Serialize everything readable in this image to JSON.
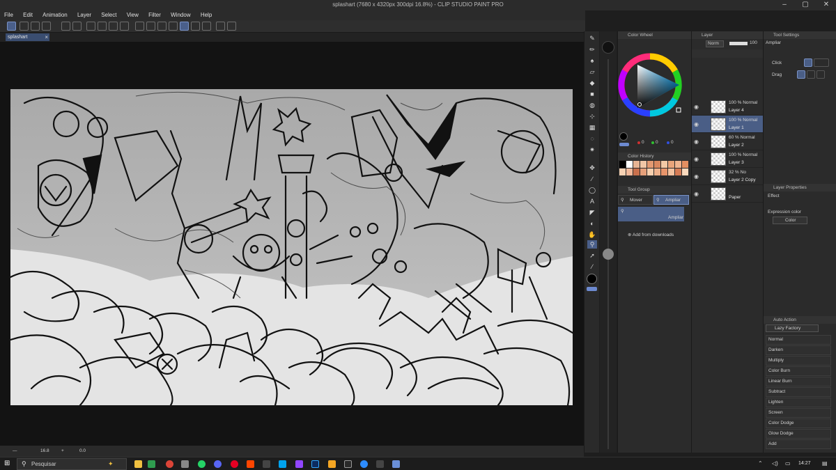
{
  "window": {
    "title": "splashart (7680 x 4320px 300dpi 16.8%) - CLIP STUDIO PAINT PRO"
  },
  "menu": [
    "File",
    "Edit",
    "Animation",
    "Layer",
    "Select",
    "View",
    "Filter",
    "Window",
    "Help"
  ],
  "document_tab": {
    "label": "splashart",
    "close": "×"
  },
  "status_bar": {
    "zoom": "16.8",
    "rotation": "0.0"
  },
  "color_wheel_panel": {
    "title": "Color Wheel",
    "rgb": {
      "r": "0",
      "g": "0",
      "b": "0"
    },
    "colors": {
      "fill": "#000000"
    }
  },
  "color_history": {
    "title": "Color History",
    "swatches": [
      "#000000",
      "#ffffff",
      "#e7b493",
      "#f1c7a6",
      "#e39a72",
      "#d9885f",
      "#f3c9a5",
      "#e9a47a",
      "#f0b590",
      "#e48f61",
      "#f7d2b4",
      "#f2b99a",
      "#c9704c",
      "#e6a07a",
      "#f6cfae",
      "#edb18c",
      "#e8956b",
      "#f3c2a0",
      "#d57b55",
      "#fad9bd"
    ]
  },
  "tool_group": {
    "title": "Tool Group",
    "items": [
      {
        "label": "Mover",
        "active": false
      },
      {
        "label": "Ampliar",
        "active": true
      }
    ],
    "current_tool": "Ampliar",
    "add_label": "Add from downloads"
  },
  "layer_panel": {
    "title": "Layer",
    "blend_mode": "Norm",
    "opacity": "100",
    "layers": [
      {
        "mode": "100 % Normal",
        "name": "Layer 4",
        "selected": false
      },
      {
        "mode": "100 % Normal",
        "name": "Layer 1",
        "selected": true
      },
      {
        "mode": "60 % Normal",
        "name": "Layer 2",
        "selected": false
      },
      {
        "mode": "100 % Normal",
        "name": "Layer 3",
        "selected": false
      },
      {
        "mode": "32 % No",
        "name": "Layer 2 Copy",
        "selected": false
      },
      {
        "mode": "",
        "name": "Paper",
        "selected": false
      }
    ]
  },
  "tool_settings": {
    "title": "Tool Settings",
    "tool_name": "Ampliar",
    "click_label": "Click",
    "drag_label": "Drag"
  },
  "layer_properties": {
    "title": "Layer Properties",
    "effect_label": "Effect",
    "expression_color_label": "Expression color",
    "expression_color_value": "Color"
  },
  "auto_action": {
    "title": "Auto Action",
    "set_name": "Lazy Factory",
    "items": [
      "Normal",
      "Darken",
      "Multiply",
      "Color Burn",
      "Linear Burn",
      "Subtract",
      "Lighten",
      "Screen",
      "Color Dodge",
      "Glow Dodge",
      "Add"
    ]
  },
  "taskbar": {
    "search_placeholder": "Pesquisar",
    "time": "14:27"
  }
}
